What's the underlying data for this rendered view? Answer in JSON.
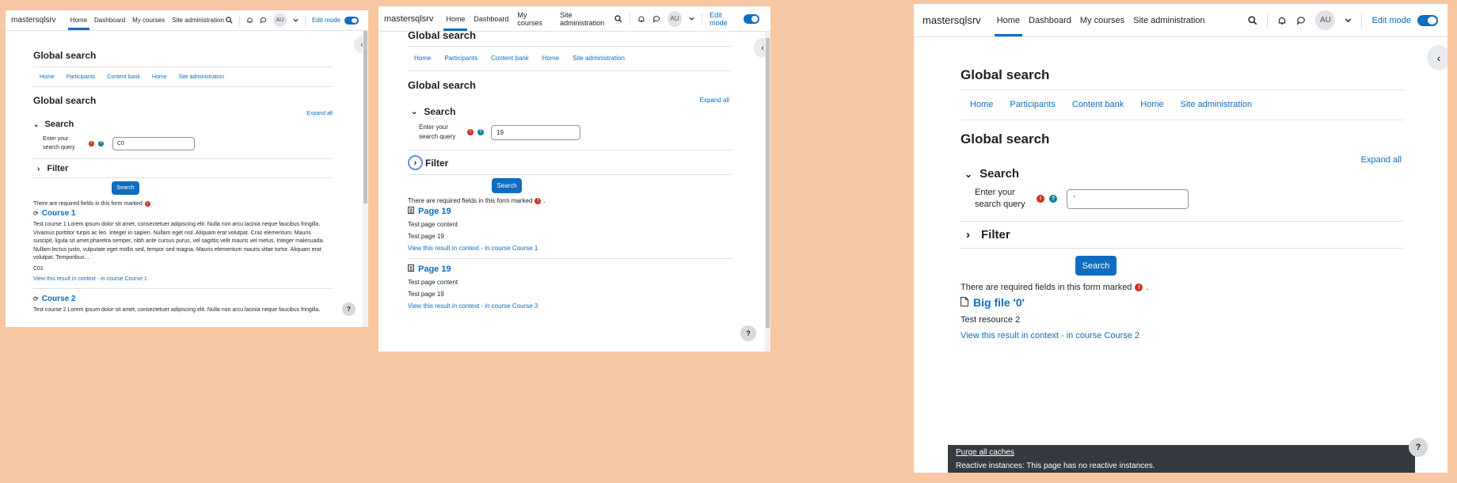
{
  "nav": {
    "brand": "mastersqlsrv",
    "links": [
      "Home",
      "Dashboard",
      "My courses",
      "Site administration"
    ],
    "avatar": "AU",
    "edit_mode": "Edit mode"
  },
  "page": {
    "title": "Global search",
    "secondary_nav": [
      "Home",
      "Participants",
      "Content bank",
      "Home",
      "Site administration"
    ],
    "form_heading": "Global search",
    "expand_all": "Expand all",
    "search_section": "Search",
    "query_label": "Enter your search query",
    "filter_section": "Filter",
    "search_button": "Search",
    "required_note": "There are required fields in this form marked",
    "required_note_end": ".",
    "view_context": "View this result in context",
    "separator": " - "
  },
  "window1": {
    "query_value": "C0",
    "results": [
      {
        "title": "Course 1",
        "content": "Test course 1 Lorem ipsum dolor sit amet, consectetuer adipiscing elit. Nulla non arcu lacinia neque faucibus fringilla. Vivamus porttitor turpis ac leo. Integer in sapien. Nullam eget nisl. Aliquam erat volutpat. Cras elementum. Mauris suscipit, ligula sit amet pharetra semper, nibh ante cursus purus, vel sagittis velit mauris vel metus. Integer malesuada. Nullam lectus justo, vulputate eget mollis sed, tempor sed magna. Mauris elementum mauris vitae tortor. Aliquam erat volutpat. Temporibus...",
        "extra": "C01",
        "course_link": "in course Course 1"
      },
      {
        "title": "Course 2",
        "content": "Test course 2 Lorem ipsum dolor sit amet, consectetuer adipiscing elit. Nulla non arcu lacinia neque faucibus fringilla."
      }
    ]
  },
  "window2": {
    "query_value": "19",
    "results": [
      {
        "title": "Page 19",
        "line1": "Test page content",
        "line2": "Test page 19",
        "course_link": "in course Course 1"
      },
      {
        "title": "Page 19",
        "line1": "Test page content",
        "line2": "Test page 19",
        "course_link": "in course Course 3"
      }
    ]
  },
  "window3": {
    "query_value": "'",
    "results": [
      {
        "title": "Big file '0'",
        "line1": "Test resource 2",
        "course_link": "in course Course 2"
      }
    ],
    "footer": {
      "purge": "Purge all caches",
      "reactive": "Reactive instances: This page has no reactive instances."
    }
  },
  "colors": {
    "accent": "#0f6cbf",
    "background": "#f7c6a3",
    "required": "#ca3120",
    "help": "#008196"
  }
}
